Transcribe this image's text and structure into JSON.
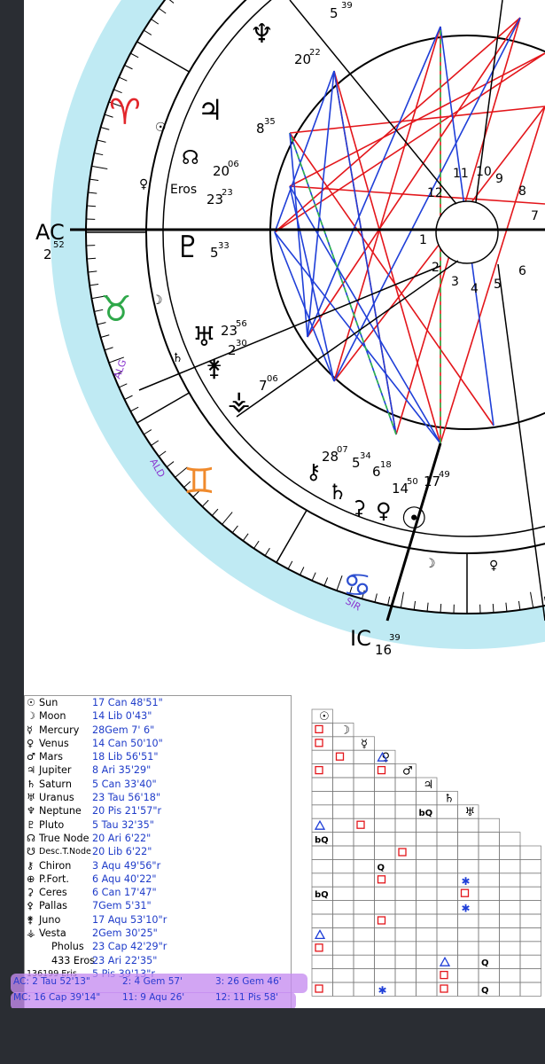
{
  "chart": {
    "ac_label": "AC",
    "ac_deg": "2",
    "ac_min": "52",
    "ic_label": "IC",
    "ic_deg": "16",
    "ic_min": "39",
    "eros_label": "Eros",
    "fixed_stars": [
      "ALG",
      "ALD",
      "SIR"
    ],
    "house_numbers": [
      "11",
      "10",
      "9",
      "8",
      "7",
      "12",
      "1",
      "2",
      "3",
      "4",
      "5",
      "6"
    ],
    "cusp_numbers": [
      {
        "label": "Neptune",
        "deg": "20",
        "min": "22"
      },
      {
        "label": "Jupiter",
        "deg": "8",
        "min": "35"
      },
      {
        "label": "True Node",
        "deg": "20",
        "min": "06"
      },
      {
        "label": "Eros",
        "deg": "23",
        "min": "23"
      },
      {
        "label": "Pluto",
        "deg": "5",
        "min": "33"
      },
      {
        "label": "Uranus",
        "deg": "23",
        "min": "56"
      },
      {
        "label": "Juno",
        "deg": "2",
        "min": "30"
      },
      {
        "label": "Vesta",
        "deg": "7",
        "min": "06"
      },
      {
        "label": "Chiron",
        "deg": "28",
        "min": "07"
      },
      {
        "label": "Ceres",
        "deg": "5",
        "min": "34"
      },
      {
        "label": "Saturn",
        "deg": "6",
        "min": "18"
      },
      {
        "label": "Venus",
        "deg": "14",
        "min": "50"
      },
      {
        "label": "Sun",
        "deg": "17",
        "min": "49"
      }
    ],
    "top_labels": [
      "5",
      "39"
    ],
    "colors": {
      "sky": "#bfeaf3",
      "red_aspect": "#e3161b",
      "blue_aspect": "#1f3fd8",
      "green_aspect": "#2fb84a",
      "sign_red": "#e2262b",
      "sign_green": "#2fa84a",
      "sign_orange": "#f08a2c",
      "sign_blue": "#2d4fd0",
      "star_purple": "#8a36d0"
    }
  },
  "planets": [
    {
      "glyph": "☉",
      "name": "Sun",
      "pos": "17 Can 48'51\""
    },
    {
      "glyph": "☽",
      "name": "Moon",
      "pos": "14  Lib   0'43\""
    },
    {
      "glyph": "☿",
      "name": "Mercury",
      "pos": "28Gem  7'  6\""
    },
    {
      "glyph": "♀",
      "name": "Venus",
      "pos": "14 Can 50'10\""
    },
    {
      "glyph": "♂",
      "name": "Mars",
      "pos": "18  Lib  56'51\""
    },
    {
      "glyph": "♃",
      "name": "Jupiter",
      "pos": "8  Ari  35'29\""
    },
    {
      "glyph": "♄",
      "name": "Saturn",
      "pos": "5 Can 33'40\""
    },
    {
      "glyph": "♅",
      "name": "Uranus",
      "pos": "23 Tau 56'18\""
    },
    {
      "glyph": "♆",
      "name": "Neptune",
      "pos": "20  Pis  21'57\"r"
    },
    {
      "glyph": "♇",
      "name": "Pluto",
      "pos": "5 Tau 32'35\""
    },
    {
      "glyph": "☊",
      "name": "True Node",
      "pos": "20  Ari    6'22\""
    },
    {
      "glyph": "☋",
      "name": "Desc.T.Node",
      "pos": "20  Lib    6'22\""
    },
    {
      "glyph": "⚷",
      "name": "Chiron",
      "pos": "3 Aqu 49'56\"r"
    },
    {
      "glyph": "⊕",
      "name": "P.Fort.",
      "pos": "6 Aqu 40'22\""
    },
    {
      "glyph": "⚳",
      "name": "Ceres",
      "pos": "6 Can 17'47\""
    },
    {
      "glyph": "⚴",
      "name": "Pallas",
      "pos": "7Gem   5'31\""
    },
    {
      "glyph": "⚵",
      "name": "Juno",
      "pos": "17 Aqu 53'10\"r"
    },
    {
      "glyph": "⚶",
      "name": "Vesta",
      "pos": "2Gem 30'25\""
    },
    {
      "glyph": "",
      "name": "Pholus",
      "pos": "23 Cap 42'29\"r"
    },
    {
      "glyph": "",
      "name": "433 Eros",
      "pos": "23  Ari  22'35\""
    },
    {
      "glyph": "",
      "name": "136199 Eris",
      "pos": "5  Pis  39'13\"r"
    }
  ],
  "houses": {
    "row1": [
      "AC:   2  Tau 52'13\"",
      "2:    4 Gem 57'",
      "3:  26 Gem 46'"
    ],
    "row2": [
      "MC:  16  Cap 39'14\"",
      "11:    9  Aqu 26'",
      "12:  11   Pis  58'"
    ]
  },
  "aspect_grid": {
    "header_glyphs": [
      "☉",
      "☽",
      "☿",
      "♀",
      "♂",
      "♃",
      "♄",
      "♅"
    ],
    "cell_text": [
      "bQ",
      "Q",
      "bQ",
      "bQ",
      "Q",
      "Q"
    ]
  }
}
